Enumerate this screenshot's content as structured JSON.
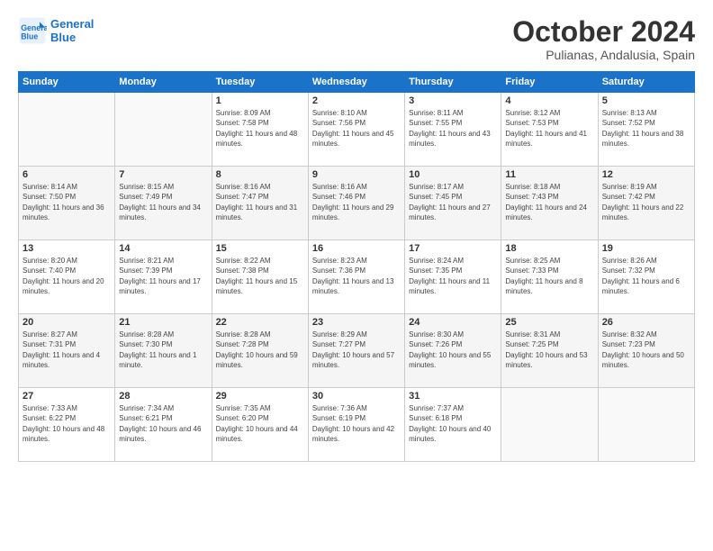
{
  "header": {
    "logo_line1": "General",
    "logo_line2": "Blue",
    "month_title": "October 2024",
    "location": "Pulianas, Andalusia, Spain"
  },
  "days_of_week": [
    "Sunday",
    "Monday",
    "Tuesday",
    "Wednesday",
    "Thursday",
    "Friday",
    "Saturday"
  ],
  "weeks": [
    [
      {
        "day": "",
        "info": ""
      },
      {
        "day": "",
        "info": ""
      },
      {
        "day": "1",
        "info": "Sunrise: 8:09 AM\nSunset: 7:58 PM\nDaylight: 11 hours and 48 minutes."
      },
      {
        "day": "2",
        "info": "Sunrise: 8:10 AM\nSunset: 7:56 PM\nDaylight: 11 hours and 45 minutes."
      },
      {
        "day": "3",
        "info": "Sunrise: 8:11 AM\nSunset: 7:55 PM\nDaylight: 11 hours and 43 minutes."
      },
      {
        "day": "4",
        "info": "Sunrise: 8:12 AM\nSunset: 7:53 PM\nDaylight: 11 hours and 41 minutes."
      },
      {
        "day": "5",
        "info": "Sunrise: 8:13 AM\nSunset: 7:52 PM\nDaylight: 11 hours and 38 minutes."
      }
    ],
    [
      {
        "day": "6",
        "info": "Sunrise: 8:14 AM\nSunset: 7:50 PM\nDaylight: 11 hours and 36 minutes."
      },
      {
        "day": "7",
        "info": "Sunrise: 8:15 AM\nSunset: 7:49 PM\nDaylight: 11 hours and 34 minutes."
      },
      {
        "day": "8",
        "info": "Sunrise: 8:16 AM\nSunset: 7:47 PM\nDaylight: 11 hours and 31 minutes."
      },
      {
        "day": "9",
        "info": "Sunrise: 8:16 AM\nSunset: 7:46 PM\nDaylight: 11 hours and 29 minutes."
      },
      {
        "day": "10",
        "info": "Sunrise: 8:17 AM\nSunset: 7:45 PM\nDaylight: 11 hours and 27 minutes."
      },
      {
        "day": "11",
        "info": "Sunrise: 8:18 AM\nSunset: 7:43 PM\nDaylight: 11 hours and 24 minutes."
      },
      {
        "day": "12",
        "info": "Sunrise: 8:19 AM\nSunset: 7:42 PM\nDaylight: 11 hours and 22 minutes."
      }
    ],
    [
      {
        "day": "13",
        "info": "Sunrise: 8:20 AM\nSunset: 7:40 PM\nDaylight: 11 hours and 20 minutes."
      },
      {
        "day": "14",
        "info": "Sunrise: 8:21 AM\nSunset: 7:39 PM\nDaylight: 11 hours and 17 minutes."
      },
      {
        "day": "15",
        "info": "Sunrise: 8:22 AM\nSunset: 7:38 PM\nDaylight: 11 hours and 15 minutes."
      },
      {
        "day": "16",
        "info": "Sunrise: 8:23 AM\nSunset: 7:36 PM\nDaylight: 11 hours and 13 minutes."
      },
      {
        "day": "17",
        "info": "Sunrise: 8:24 AM\nSunset: 7:35 PM\nDaylight: 11 hours and 11 minutes."
      },
      {
        "day": "18",
        "info": "Sunrise: 8:25 AM\nSunset: 7:33 PM\nDaylight: 11 hours and 8 minutes."
      },
      {
        "day": "19",
        "info": "Sunrise: 8:26 AM\nSunset: 7:32 PM\nDaylight: 11 hours and 6 minutes."
      }
    ],
    [
      {
        "day": "20",
        "info": "Sunrise: 8:27 AM\nSunset: 7:31 PM\nDaylight: 11 hours and 4 minutes."
      },
      {
        "day": "21",
        "info": "Sunrise: 8:28 AM\nSunset: 7:30 PM\nDaylight: 11 hours and 1 minute."
      },
      {
        "day": "22",
        "info": "Sunrise: 8:28 AM\nSunset: 7:28 PM\nDaylight: 10 hours and 59 minutes."
      },
      {
        "day": "23",
        "info": "Sunrise: 8:29 AM\nSunset: 7:27 PM\nDaylight: 10 hours and 57 minutes."
      },
      {
        "day": "24",
        "info": "Sunrise: 8:30 AM\nSunset: 7:26 PM\nDaylight: 10 hours and 55 minutes."
      },
      {
        "day": "25",
        "info": "Sunrise: 8:31 AM\nSunset: 7:25 PM\nDaylight: 10 hours and 53 minutes."
      },
      {
        "day": "26",
        "info": "Sunrise: 8:32 AM\nSunset: 7:23 PM\nDaylight: 10 hours and 50 minutes."
      }
    ],
    [
      {
        "day": "27",
        "info": "Sunrise: 7:33 AM\nSunset: 6:22 PM\nDaylight: 10 hours and 48 minutes."
      },
      {
        "day": "28",
        "info": "Sunrise: 7:34 AM\nSunset: 6:21 PM\nDaylight: 10 hours and 46 minutes."
      },
      {
        "day": "29",
        "info": "Sunrise: 7:35 AM\nSunset: 6:20 PM\nDaylight: 10 hours and 44 minutes."
      },
      {
        "day": "30",
        "info": "Sunrise: 7:36 AM\nSunset: 6:19 PM\nDaylight: 10 hours and 42 minutes."
      },
      {
        "day": "31",
        "info": "Sunrise: 7:37 AM\nSunset: 6:18 PM\nDaylight: 10 hours and 40 minutes."
      },
      {
        "day": "",
        "info": ""
      },
      {
        "day": "",
        "info": ""
      }
    ]
  ]
}
